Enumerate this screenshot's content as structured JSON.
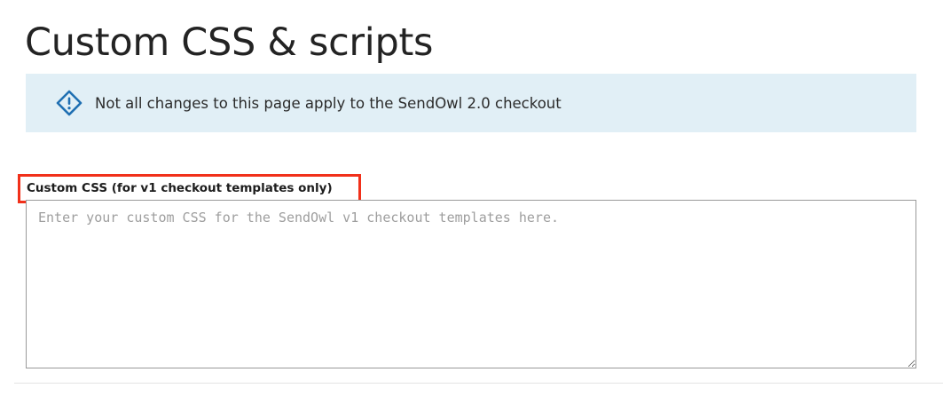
{
  "page": {
    "title": "Custom CSS & scripts"
  },
  "notice": {
    "icon": "info-diamond-icon",
    "text": "Not all changes to this page apply to the SendOwl 2.0 checkout",
    "background": "#e1eff6",
    "icon_color": "#1f6fb2"
  },
  "custom_css": {
    "label": "Custom CSS (for v1 checkout templates only)",
    "placeholder": "Enter your custom CSS for the SendOwl v1 checkout templates here.",
    "value": "",
    "highlight_color": "#f1301a"
  }
}
